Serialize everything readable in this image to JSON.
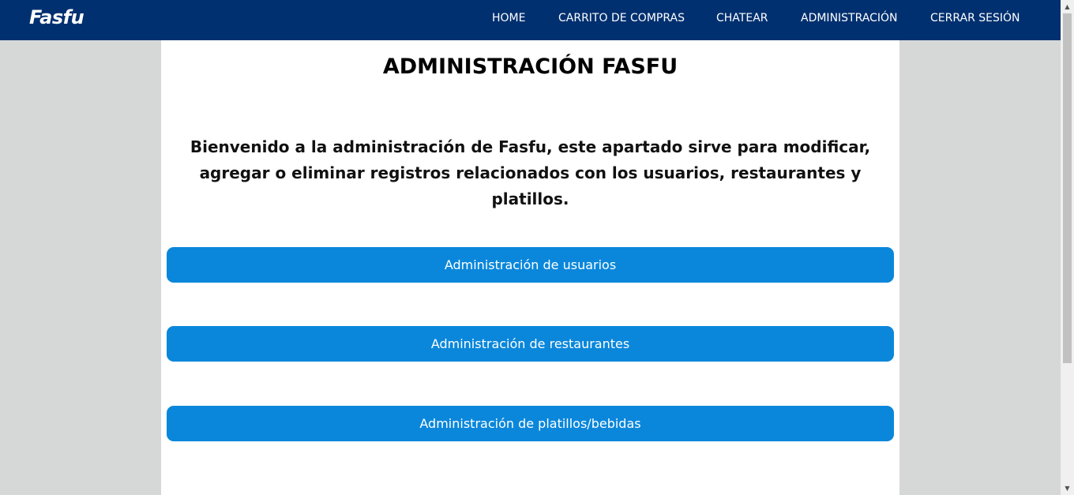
{
  "navbar": {
    "brand": "Fasfu",
    "items": [
      {
        "label": "HOME"
      },
      {
        "label": "CARRITO DE COMPRAS"
      },
      {
        "label": "CHATEAR"
      },
      {
        "label": "ADMINISTRACIÓN"
      },
      {
        "label": "CERRAR SESIÓN"
      }
    ]
  },
  "main": {
    "title": "ADMINISTRACIÓN FASFU",
    "intro": "Bienvenido a la administración de Fasfu, este apartado sirve para modificar, agregar o eliminar registros relacionados con los usuarios, restaurantes y platillos.",
    "buttons": [
      {
        "label": "Administración de usuarios"
      },
      {
        "label": "Administración de restaurantes"
      },
      {
        "label": "Administración de platillos/bebidas"
      }
    ]
  },
  "colors": {
    "navbar_bg": "#003070",
    "button_bg": "#0a87db",
    "page_bg": "#d6d7d7",
    "content_bg": "#ffffff"
  },
  "icons": {
    "scroll_up": "▲",
    "scroll_down": "▼"
  }
}
